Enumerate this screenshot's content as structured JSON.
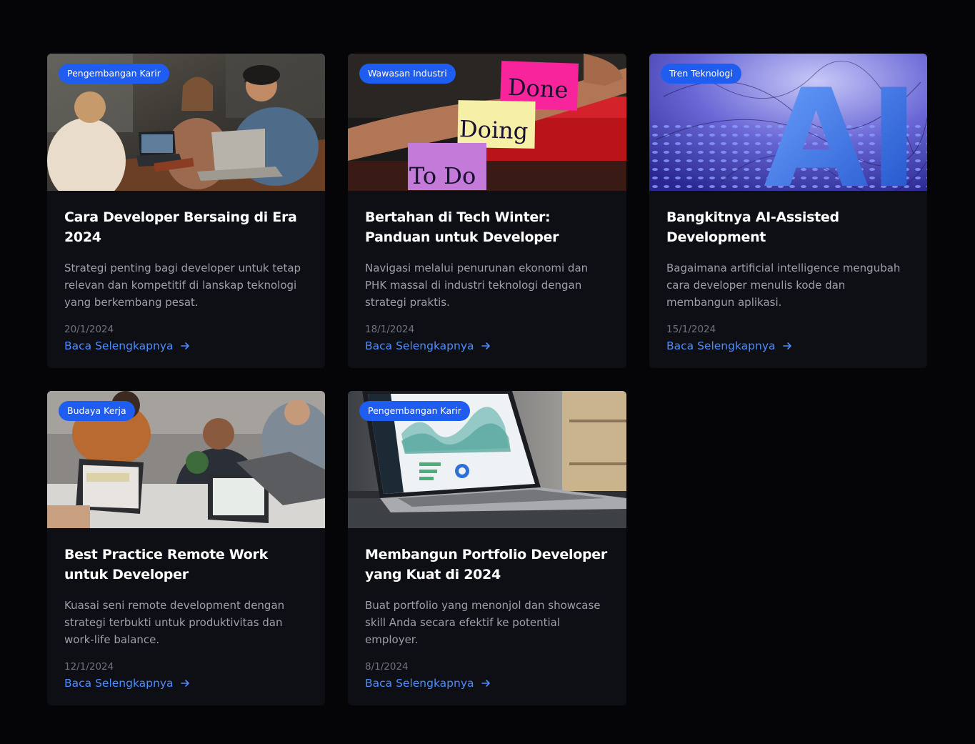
{
  "read_more_label": "Baca Selengkapnya",
  "colors": {
    "background": "#050508",
    "card": "#0d0f14",
    "badge": "#1f5cf0",
    "link": "#4d8cff"
  },
  "posts": [
    {
      "category": "Pengembangan Karir",
      "title": "Cara Developer Bersaing di Era 2024",
      "excerpt": "Strategi penting bagi developer untuk tetap relevan dan kompetitif di lanskap teknologi yang berkembang pesat.",
      "date": "20/1/2024",
      "image": "team-laptops-cafe"
    },
    {
      "category": "Wawasan Industri",
      "title": "Bertahan di Tech Winter: Panduan untuk Developer",
      "excerpt": "Navigasi melalui penurunan ekonomi dan PHK massal di industri teknologi dengan strategi praktis.",
      "date": "18/1/2024",
      "image": "sticky-notes-todo-doing-done"
    },
    {
      "category": "Tren Teknologi",
      "title": "Bangkitnya AI-Assisted Development",
      "excerpt": "Bagaimana artificial intelligence mengubah cara developer menulis kode dan membangun aplikasi.",
      "date": "15/1/2024",
      "image": "ai-3d-letters"
    },
    {
      "category": "Budaya Kerja",
      "title": "Best Practice Remote Work untuk Developer",
      "excerpt": "Kuasai seni remote development dengan strategi terbukti untuk produktivitas dan work-life balance.",
      "date": "12/1/2024",
      "image": "coworking-laptops"
    },
    {
      "category": "Pengembangan Karir",
      "title": "Membangun Portfolio Developer yang Kuat di 2024",
      "excerpt": "Buat portfolio yang menonjol dan showcase skill Anda secara efektif ke potential employer.",
      "date": "8/1/2024",
      "image": "laptop-dashboard"
    }
  ],
  "sticky_notes": {
    "todo": "To Do",
    "doing": "Doing",
    "done": "Done"
  },
  "ai_letters": "AI"
}
